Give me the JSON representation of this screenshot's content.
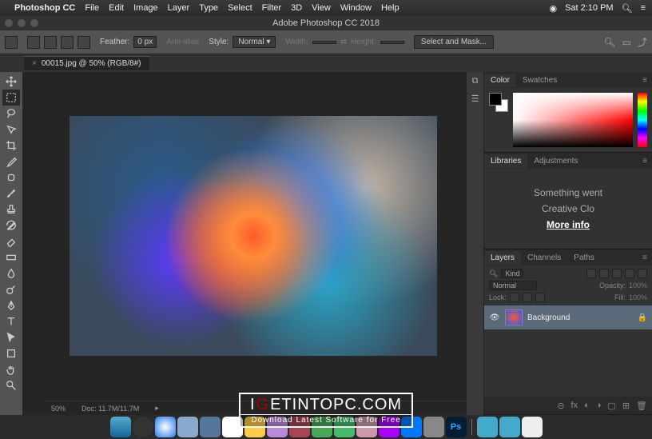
{
  "menubar": {
    "app_name": "Photoshop CC",
    "items": [
      "File",
      "Edit",
      "Image",
      "Layer",
      "Type",
      "Select",
      "Filter",
      "3D",
      "View",
      "Window",
      "Help"
    ],
    "clock": "Sat 2:10 PM"
  },
  "window": {
    "title": "Adobe Photoshop CC 2018"
  },
  "options": {
    "feather_label": "Feather:",
    "feather_value": "0 px",
    "antialias": "Anti-alias",
    "style_label": "Style:",
    "style_value": "Normal",
    "width_label": "Width:",
    "height_label": "Height:",
    "select_mask": "Select and Mask..."
  },
  "document": {
    "tab": "00015.jpg @ 50% (RGB/8#)",
    "zoom": "50%",
    "doc_info": "Doc: 11.7M/11.7M"
  },
  "panels": {
    "color": {
      "tabs": [
        "Color",
        "Swatches"
      ]
    },
    "lib": {
      "tabs": [
        "Libraries",
        "Adjustments"
      ],
      "msg1": "Something went",
      "msg2": "Creative Clo",
      "link": "More info"
    },
    "layers": {
      "tabs": [
        "Layers",
        "Channels",
        "Paths"
      ],
      "kind": "Kind",
      "blend": "Normal",
      "opacity_label": "Opacity:",
      "opacity_value": "100%",
      "lock_label": "Lock:",
      "fill_label": "Fill:",
      "fill_value": "100%",
      "layer_name": "Background"
    }
  },
  "watermark": {
    "line1_pre": "I",
    "line1_g": "G",
    "line1_rest": "ETINTOPC.COM",
    "line2": "Download Latest Software for Free"
  }
}
